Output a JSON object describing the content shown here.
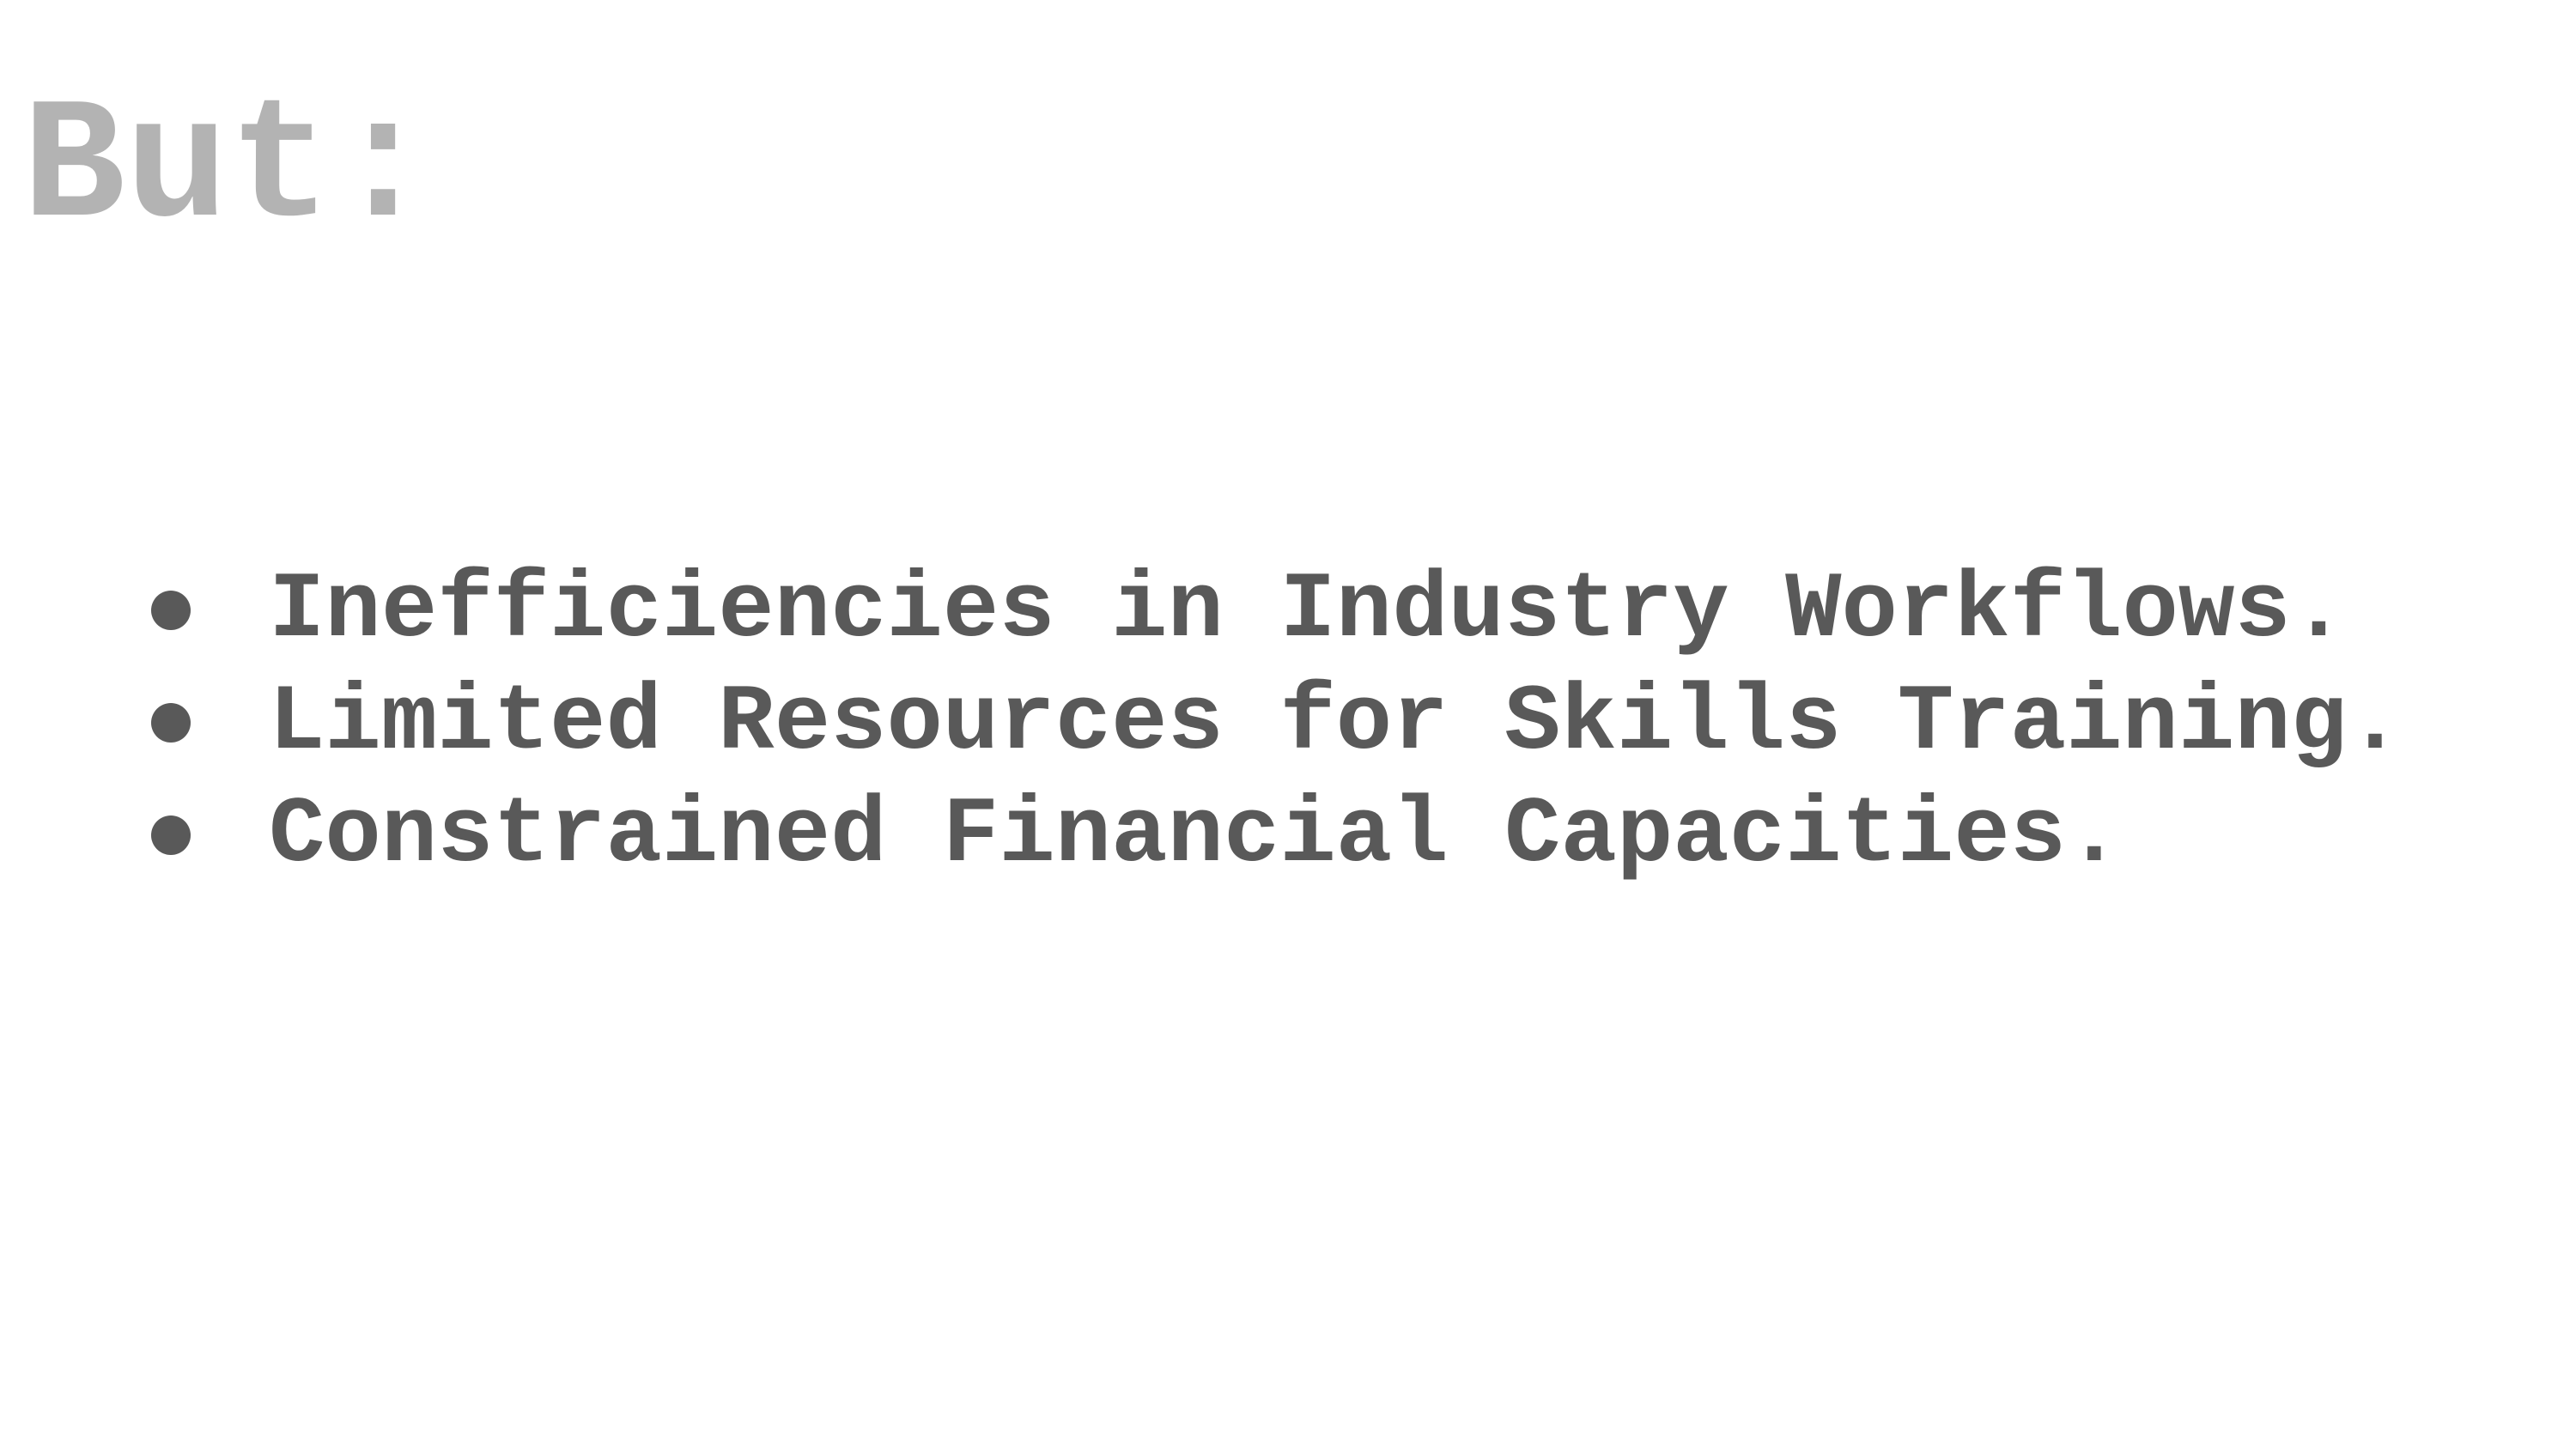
{
  "slide": {
    "title": "But:",
    "bullets": [
      "Inefficiencies in Industry Workflows.",
      "Limited Resources for Skills Training.",
      "Constrained Financial Capacities."
    ]
  },
  "colors": {
    "background": "#ffffff",
    "title": "#b3b3b3",
    "body_text": "#595959"
  }
}
